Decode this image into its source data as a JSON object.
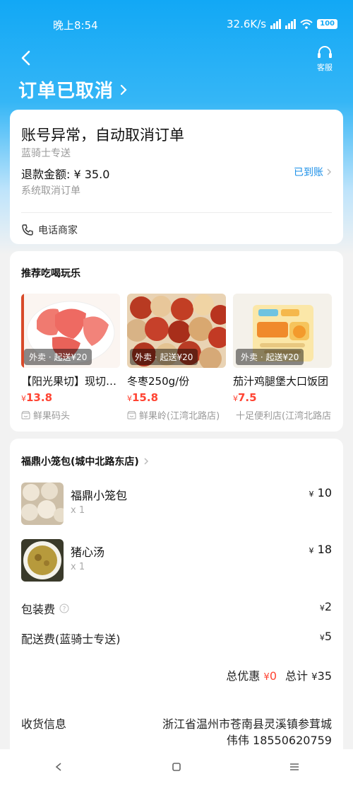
{
  "status_bar": {
    "time": "晚上8:54",
    "network_speed": "32.6K/s",
    "battery": "100"
  },
  "header": {
    "title": "订单已取消",
    "service_label": "客服"
  },
  "cancel_card": {
    "reason": "账号异常，自动取消订单",
    "rider": "蓝骑士专送",
    "refund_label": "退款金额: ¥ 35.0",
    "refund_status": "已到账",
    "cancel_source": "系统取消订单",
    "call_label": "电话商家"
  },
  "recommend": {
    "title": "推荐吃喝玩乐",
    "items": [
      {
        "tag": "外卖 · 起送¥20",
        "name": "【阳光果切】现切西柚",
        "price": "13.8",
        "shop": "鲜果码头"
      },
      {
        "tag": "外卖 · 起送¥20",
        "name": "冬枣250g/份",
        "price": "15.8",
        "shop": "鲜果岭(江湾北路店)"
      },
      {
        "tag": "外卖 · 起送¥20",
        "name": "茄汁鸡腿堡大口饭团",
        "price": "7.5",
        "shop": "十足便利店(江湾北路店)"
      }
    ]
  },
  "order": {
    "shop_name": "福鼎小笼包(城中北路东店)",
    "items": [
      {
        "name": "福鼎小笼包",
        "qty": "x 1",
        "price": "10"
      },
      {
        "name": "猪心汤",
        "qty": "x 1",
        "price": "18"
      }
    ],
    "packing_fee_label": "包装费",
    "packing_fee": "2",
    "delivery_fee_label": "配送费(蓝骑士专送)",
    "delivery_fee": "5",
    "discount_label": "总优惠",
    "discount": "0",
    "total_label": "总计",
    "total": "35",
    "currency": "¥"
  },
  "address": {
    "label": "收货信息",
    "address": "浙江省温州市苍南县灵溪镇参茸城",
    "contact": "伟伟 18550620759"
  },
  "colors": {
    "brand": "#12a8f5",
    "price_red": "#ff4433",
    "link_blue": "#1a8fe8"
  }
}
